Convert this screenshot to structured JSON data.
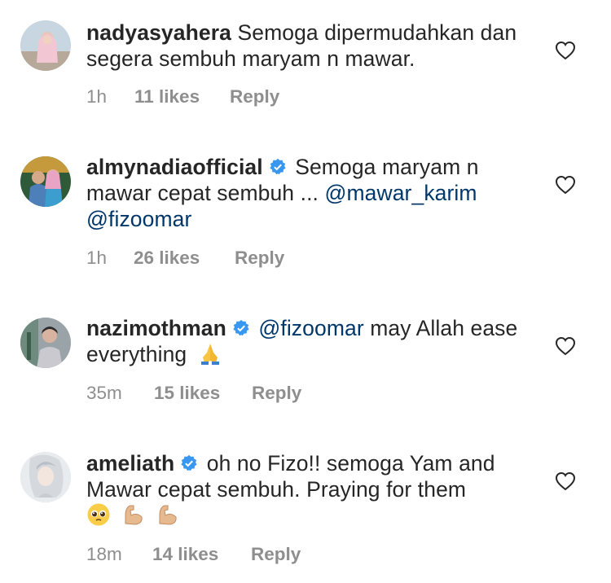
{
  "comments": [
    {
      "username": "nadyasyahera",
      "verified": false,
      "text": "Semoga dipermudahkan dan segera sembuh maryam n mawar.",
      "time": "1h",
      "likes": "11 likes",
      "reply": "Reply",
      "avatar_icon": "profile-photo-woman-hijab"
    },
    {
      "username": "almynadiaofficial",
      "verified": true,
      "text": "Semoga maryam n mawar cepat sembuh ...",
      "mention1": "@mawar_karim",
      "mention2": "@fizoomar",
      "time": "1h",
      "likes": "26 likes",
      "reply": "Reply",
      "avatar_icon": "profile-photo-couple"
    },
    {
      "username": "nazimothman",
      "verified": true,
      "mention": "@fizoomar",
      "text": "may Allah ease everything",
      "emoji": "folded-hands-emoji",
      "time": "35m",
      "likes": "15 likes",
      "reply": "Reply",
      "avatar_icon": "profile-photo-man"
    },
    {
      "username": "ameliath",
      "verified": true,
      "text": "oh no Fizo!! semoga Yam and Mawar cepat sembuh. Praying for them",
      "emojis": [
        "pleading-face-emoji",
        "flexed-biceps-emoji",
        "flexed-biceps-emoji"
      ],
      "time": "18m",
      "likes": "14 likes",
      "reply": "Reply",
      "avatar_icon": "profile-photo-woman-portrait"
    }
  ],
  "colors": {
    "text": "#262626",
    "meta": "#8e8e8e",
    "mention": "#00376b",
    "verified": "#3897f0"
  }
}
